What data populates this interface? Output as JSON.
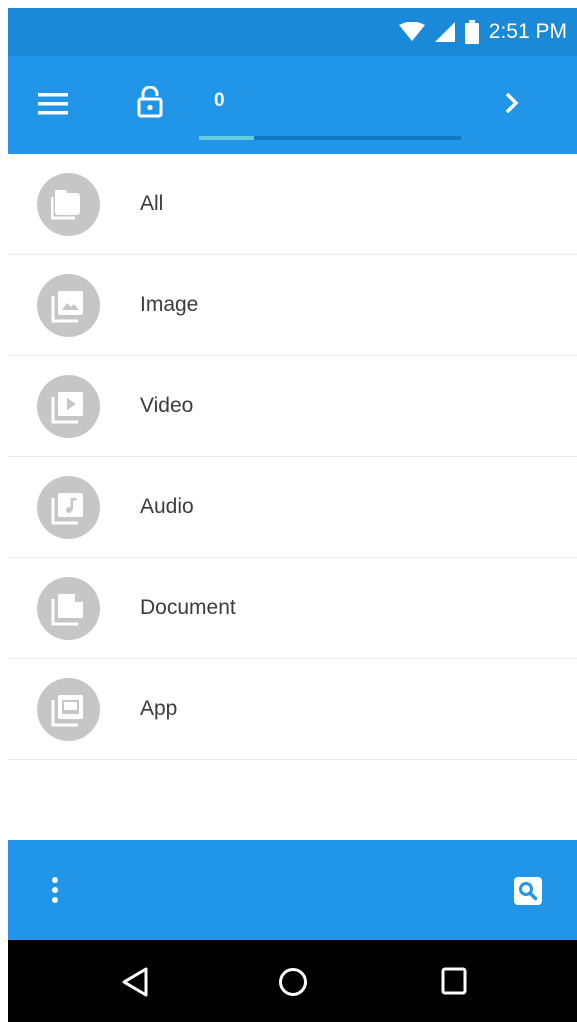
{
  "status_bar": {
    "time": "2:51 PM",
    "icons": [
      "wifi-icon",
      "signal-icon",
      "battery-icon"
    ]
  },
  "app_bar": {
    "menu_icon": "menu-icon",
    "lock_icon": "lock-open-icon",
    "counter": "0",
    "next_icon": "chevron-right-icon",
    "progress_fraction": 0.21
  },
  "categories": [
    {
      "label": "All",
      "icon": "folder-icon"
    },
    {
      "label": "Image",
      "icon": "image-icon"
    },
    {
      "label": "Video",
      "icon": "video-icon"
    },
    {
      "label": "Audio",
      "icon": "audio-icon"
    },
    {
      "label": "Document",
      "icon": "document-icon"
    },
    {
      "label": "App",
      "icon": "app-icon"
    }
  ],
  "bottom_bar": {
    "more_icon": "more-vert-icon",
    "search_icon": "search-icon"
  },
  "nav_bar": {
    "icons": [
      "back-icon",
      "home-icon",
      "recents-icon"
    ]
  },
  "colors": {
    "status_bar": "#1a8ad8",
    "primary": "#2196e8",
    "progress_track": "#1378c4",
    "progress_fill": "#67cde0",
    "icon_circle": "#c6c6c6",
    "label_text": "#3c3c3c"
  }
}
